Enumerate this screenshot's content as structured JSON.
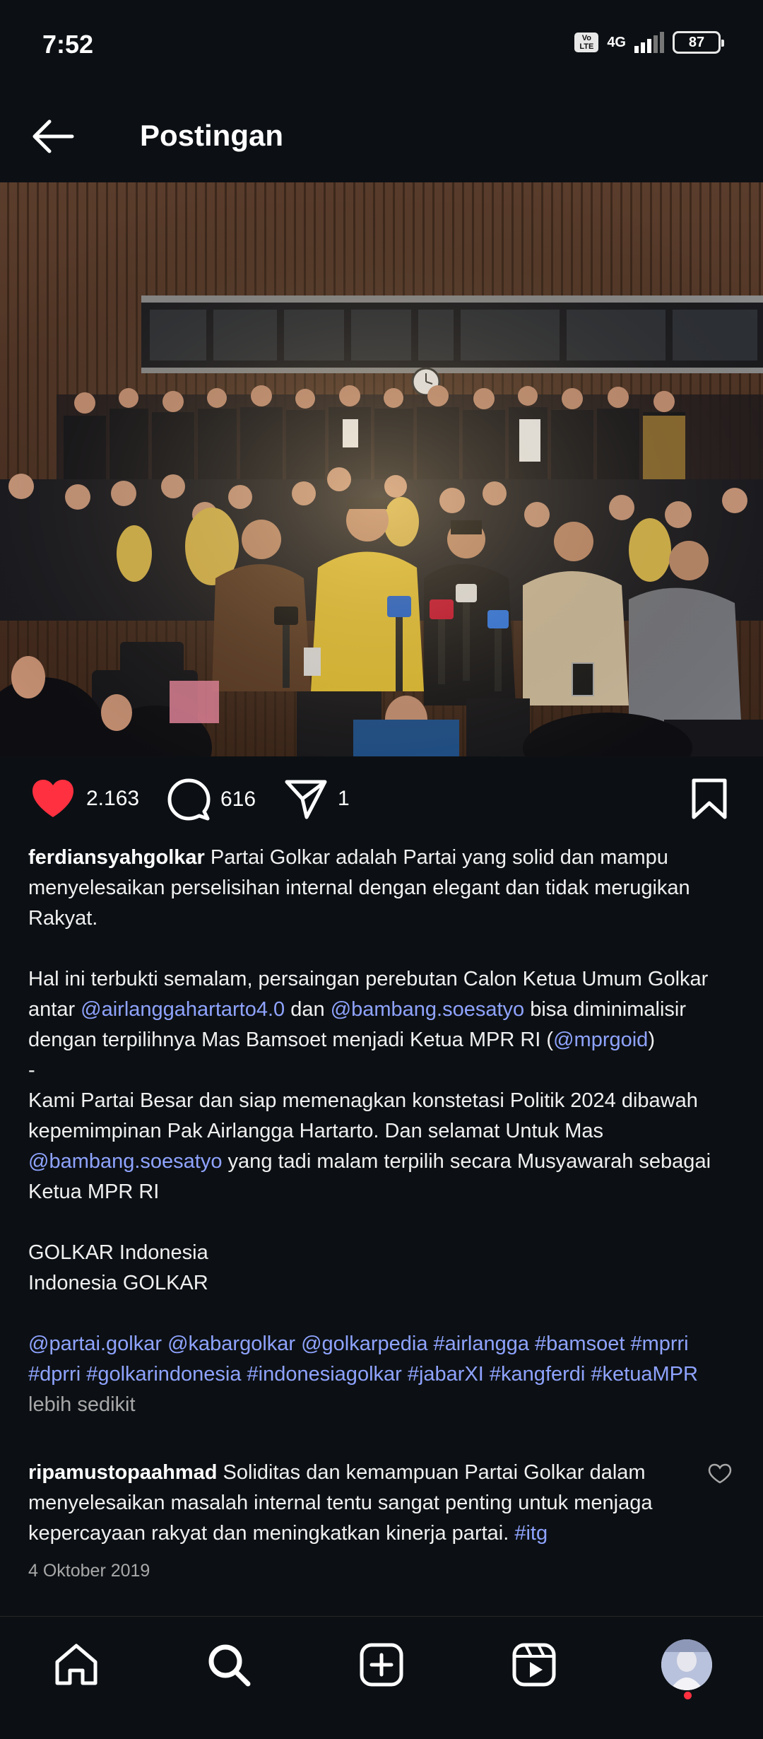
{
  "status_bar": {
    "time": "7:52",
    "volte": "VoLTE",
    "network": "4G",
    "battery": "87"
  },
  "header": {
    "title": "Postingan",
    "back_icon": "arrow-left-icon"
  },
  "post": {
    "likes": "2.163",
    "comments": "616",
    "shares": "1",
    "caption": {
      "username": "ferdiansyahgolkar",
      "p1": " Partai Golkar adalah Partai yang solid dan mampu menyelesaikan perselisihan internal dengan elegant dan tidak merugikan Rakyat.",
      "p2a": "Hal ini terbukti semalam, persaingan perebutan Calon Ketua Umum Golkar antar ",
      "mention_airlangga": "@airlanggahartarto4.0",
      "p2b": " dan ",
      "mention_bamsoet": "@bambang.soesatyo",
      "p2c": " bisa diminimalisir dengan terpilihnya Mas Bamsoet menjadi Ketua MPR RI (",
      "mention_mpr": "@mprgoid",
      "p2d": ")",
      "dash": "-",
      "p3a": "Kami Partai Besar dan siap memenagkan konstetasi Politik 2024 dibawah kepemimpinan Pak Airlangga Hartarto. Dan selamat Untuk Mas ",
      "mention_bamsoet2": "@bambang.soesatyo",
      "p3b": " yang tadi malam terpilih secara Musyawarah sebagai Ketua MPR RI",
      "p4": "GOLKAR Indonesia",
      "p5": "Indonesia GOLKAR",
      "tags": "@partai.golkar @kabargolkar @golkarpedia #airlangga #bamsoet #mprri #dprri #golkarindonesia #indonesiagolkar #jabarXI #kangferdi #ketuaMPR",
      "more": " lebih sedikit"
    },
    "comment": {
      "username": "ripamustopaahmad",
      "text": " Soliditas dan kemampuan Partai Golkar dalam menyelesaikan masalah internal tentu sangat penting untuk menjaga kepercayaan rakyat dan meningkatkan kinerja partai. ",
      "tag": "#itg"
    },
    "date": "4 Oktober 2019"
  },
  "nav": {
    "items": [
      "home-icon",
      "search-icon",
      "create-icon",
      "reels-icon",
      "profile-avatar"
    ]
  },
  "colors": {
    "background": "#0c1014",
    "link": "#8fa3ff",
    "like": "#ff3040",
    "muted": "#a8a8a8"
  }
}
